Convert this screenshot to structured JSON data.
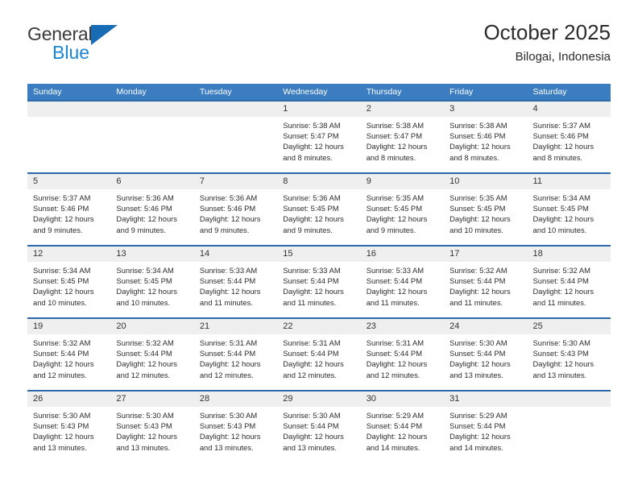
{
  "brand": {
    "name_top": "General",
    "name_bottom": "Blue",
    "triangle_color": "#176cb5",
    "blue_text_color": "#1a84d6"
  },
  "header": {
    "title": "October 2025",
    "subtitle": "Bilogai, Indonesia"
  },
  "theme": {
    "header_bg": "#3b7dc0",
    "row_rule": "#2b69ab",
    "daynum_bg": "#efefef",
    "text": "#2d2d2d"
  },
  "calendar": {
    "weekdays": [
      "Sunday",
      "Monday",
      "Tuesday",
      "Wednesday",
      "Thursday",
      "Friday",
      "Saturday"
    ],
    "weeks": [
      [
        {
          "day": "",
          "sunrise": "",
          "sunset": "",
          "daylight_1": "",
          "daylight_2": ""
        },
        {
          "day": "",
          "sunrise": "",
          "sunset": "",
          "daylight_1": "",
          "daylight_2": ""
        },
        {
          "day": "",
          "sunrise": "",
          "sunset": "",
          "daylight_1": "",
          "daylight_2": ""
        },
        {
          "day": "1",
          "sunrise": "Sunrise: 5:38 AM",
          "sunset": "Sunset: 5:47 PM",
          "daylight_1": "Daylight: 12 hours",
          "daylight_2": "and 8 minutes."
        },
        {
          "day": "2",
          "sunrise": "Sunrise: 5:38 AM",
          "sunset": "Sunset: 5:47 PM",
          "daylight_1": "Daylight: 12 hours",
          "daylight_2": "and 8 minutes."
        },
        {
          "day": "3",
          "sunrise": "Sunrise: 5:38 AM",
          "sunset": "Sunset: 5:46 PM",
          "daylight_1": "Daylight: 12 hours",
          "daylight_2": "and 8 minutes."
        },
        {
          "day": "4",
          "sunrise": "Sunrise: 5:37 AM",
          "sunset": "Sunset: 5:46 PM",
          "daylight_1": "Daylight: 12 hours",
          "daylight_2": "and 8 minutes."
        }
      ],
      [
        {
          "day": "5",
          "sunrise": "Sunrise: 5:37 AM",
          "sunset": "Sunset: 5:46 PM",
          "daylight_1": "Daylight: 12 hours",
          "daylight_2": "and 9 minutes."
        },
        {
          "day": "6",
          "sunrise": "Sunrise: 5:36 AM",
          "sunset": "Sunset: 5:46 PM",
          "daylight_1": "Daylight: 12 hours",
          "daylight_2": "and 9 minutes."
        },
        {
          "day": "7",
          "sunrise": "Sunrise: 5:36 AM",
          "sunset": "Sunset: 5:46 PM",
          "daylight_1": "Daylight: 12 hours",
          "daylight_2": "and 9 minutes."
        },
        {
          "day": "8",
          "sunrise": "Sunrise: 5:36 AM",
          "sunset": "Sunset: 5:45 PM",
          "daylight_1": "Daylight: 12 hours",
          "daylight_2": "and 9 minutes."
        },
        {
          "day": "9",
          "sunrise": "Sunrise: 5:35 AM",
          "sunset": "Sunset: 5:45 PM",
          "daylight_1": "Daylight: 12 hours",
          "daylight_2": "and 9 minutes."
        },
        {
          "day": "10",
          "sunrise": "Sunrise: 5:35 AM",
          "sunset": "Sunset: 5:45 PM",
          "daylight_1": "Daylight: 12 hours",
          "daylight_2": "and 10 minutes."
        },
        {
          "day": "11",
          "sunrise": "Sunrise: 5:34 AM",
          "sunset": "Sunset: 5:45 PM",
          "daylight_1": "Daylight: 12 hours",
          "daylight_2": "and 10 minutes."
        }
      ],
      [
        {
          "day": "12",
          "sunrise": "Sunrise: 5:34 AM",
          "sunset": "Sunset: 5:45 PM",
          "daylight_1": "Daylight: 12 hours",
          "daylight_2": "and 10 minutes."
        },
        {
          "day": "13",
          "sunrise": "Sunrise: 5:34 AM",
          "sunset": "Sunset: 5:45 PM",
          "daylight_1": "Daylight: 12 hours",
          "daylight_2": "and 10 minutes."
        },
        {
          "day": "14",
          "sunrise": "Sunrise: 5:33 AM",
          "sunset": "Sunset: 5:44 PM",
          "daylight_1": "Daylight: 12 hours",
          "daylight_2": "and 11 minutes."
        },
        {
          "day": "15",
          "sunrise": "Sunrise: 5:33 AM",
          "sunset": "Sunset: 5:44 PM",
          "daylight_1": "Daylight: 12 hours",
          "daylight_2": "and 11 minutes."
        },
        {
          "day": "16",
          "sunrise": "Sunrise: 5:33 AM",
          "sunset": "Sunset: 5:44 PM",
          "daylight_1": "Daylight: 12 hours",
          "daylight_2": "and 11 minutes."
        },
        {
          "day": "17",
          "sunrise": "Sunrise: 5:32 AM",
          "sunset": "Sunset: 5:44 PM",
          "daylight_1": "Daylight: 12 hours",
          "daylight_2": "and 11 minutes."
        },
        {
          "day": "18",
          "sunrise": "Sunrise: 5:32 AM",
          "sunset": "Sunset: 5:44 PM",
          "daylight_1": "Daylight: 12 hours",
          "daylight_2": "and 11 minutes."
        }
      ],
      [
        {
          "day": "19",
          "sunrise": "Sunrise: 5:32 AM",
          "sunset": "Sunset: 5:44 PM",
          "daylight_1": "Daylight: 12 hours",
          "daylight_2": "and 12 minutes."
        },
        {
          "day": "20",
          "sunrise": "Sunrise: 5:32 AM",
          "sunset": "Sunset: 5:44 PM",
          "daylight_1": "Daylight: 12 hours",
          "daylight_2": "and 12 minutes."
        },
        {
          "day": "21",
          "sunrise": "Sunrise: 5:31 AM",
          "sunset": "Sunset: 5:44 PM",
          "daylight_1": "Daylight: 12 hours",
          "daylight_2": "and 12 minutes."
        },
        {
          "day": "22",
          "sunrise": "Sunrise: 5:31 AM",
          "sunset": "Sunset: 5:44 PM",
          "daylight_1": "Daylight: 12 hours",
          "daylight_2": "and 12 minutes."
        },
        {
          "day": "23",
          "sunrise": "Sunrise: 5:31 AM",
          "sunset": "Sunset: 5:44 PM",
          "daylight_1": "Daylight: 12 hours",
          "daylight_2": "and 12 minutes."
        },
        {
          "day": "24",
          "sunrise": "Sunrise: 5:30 AM",
          "sunset": "Sunset: 5:44 PM",
          "daylight_1": "Daylight: 12 hours",
          "daylight_2": "and 13 minutes."
        },
        {
          "day": "25",
          "sunrise": "Sunrise: 5:30 AM",
          "sunset": "Sunset: 5:43 PM",
          "daylight_1": "Daylight: 12 hours",
          "daylight_2": "and 13 minutes."
        }
      ],
      [
        {
          "day": "26",
          "sunrise": "Sunrise: 5:30 AM",
          "sunset": "Sunset: 5:43 PM",
          "daylight_1": "Daylight: 12 hours",
          "daylight_2": "and 13 minutes."
        },
        {
          "day": "27",
          "sunrise": "Sunrise: 5:30 AM",
          "sunset": "Sunset: 5:43 PM",
          "daylight_1": "Daylight: 12 hours",
          "daylight_2": "and 13 minutes."
        },
        {
          "day": "28",
          "sunrise": "Sunrise: 5:30 AM",
          "sunset": "Sunset: 5:43 PM",
          "daylight_1": "Daylight: 12 hours",
          "daylight_2": "and 13 minutes."
        },
        {
          "day": "29",
          "sunrise": "Sunrise: 5:30 AM",
          "sunset": "Sunset: 5:44 PM",
          "daylight_1": "Daylight: 12 hours",
          "daylight_2": "and 13 minutes."
        },
        {
          "day": "30",
          "sunrise": "Sunrise: 5:29 AM",
          "sunset": "Sunset: 5:44 PM",
          "daylight_1": "Daylight: 12 hours",
          "daylight_2": "and 14 minutes."
        },
        {
          "day": "31",
          "sunrise": "Sunrise: 5:29 AM",
          "sunset": "Sunset: 5:44 PM",
          "daylight_1": "Daylight: 12 hours",
          "daylight_2": "and 14 minutes."
        },
        {
          "day": "",
          "sunrise": "",
          "sunset": "",
          "daylight_1": "",
          "daylight_2": ""
        }
      ]
    ]
  }
}
